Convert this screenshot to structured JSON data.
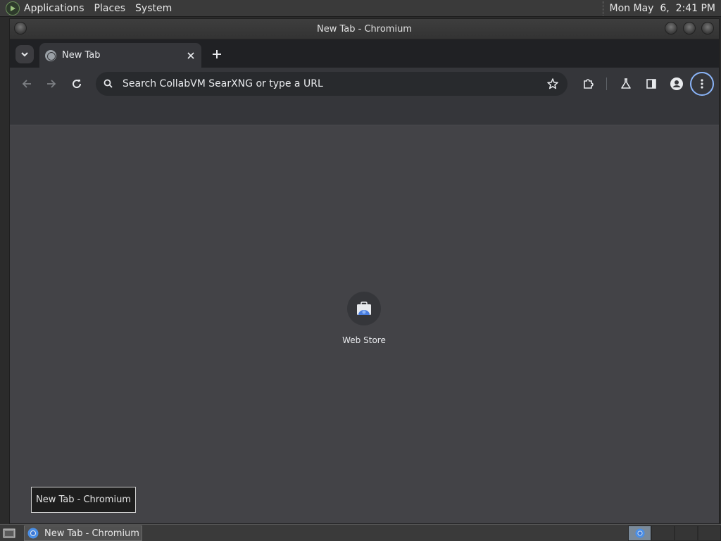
{
  "top_panel": {
    "menus": [
      "Applications",
      "Places",
      "System"
    ],
    "clock": "Mon May  6,  2:41 PM"
  },
  "window": {
    "title": "New Tab - Chromium"
  },
  "tab": {
    "title": "New Tab",
    "close_icon": "close-icon",
    "new_tab_icon": "plus-icon"
  },
  "toolbar": {
    "omnibox_placeholder": "Search CollabVM SearXNG or type a URL"
  },
  "content": {
    "shortcut_label": "Web Store"
  },
  "tooltip": {
    "text": "New Tab - Chromium"
  },
  "taskbar": {
    "task_label": "New Tab - Chromium"
  },
  "colors": {
    "focus_ring": "#8ab4f8",
    "content_bg": "#434347",
    "toolbar_bg": "#35363a",
    "tabstrip_bg": "#202124"
  }
}
